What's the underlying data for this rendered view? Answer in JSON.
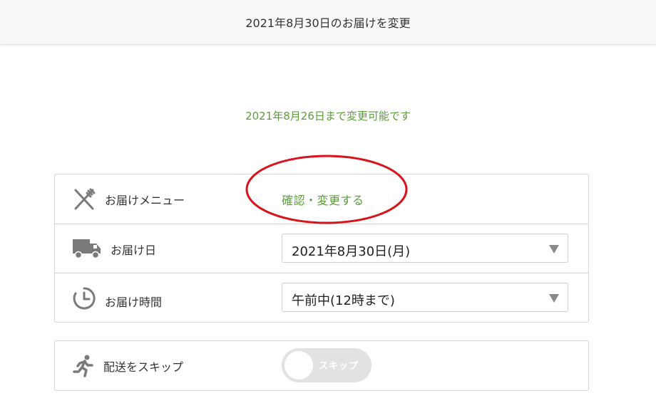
{
  "header": {
    "title": "2021年8月30日のお届けを変更"
  },
  "deadline_text": "2021年8月26日まで変更可能です",
  "rows": {
    "menu": {
      "label": "お届けメニュー",
      "icon": "fork-knife-icon",
      "action": "確認・変更する"
    },
    "date": {
      "label": "お届け日",
      "icon": "truck-icon",
      "selected": "2021年8月30日(月)"
    },
    "time": {
      "label": "お届け時間",
      "icon": "clock-icon",
      "selected": "午前中(12時まで)"
    }
  },
  "skip": {
    "label": "配送をスキップ",
    "icon": "running-person-icon",
    "toggle_text": "スキップ"
  },
  "colors": {
    "accent_green": "#5a9e3a",
    "annotation_red": "#d9121b",
    "toggle_off": "#e2e2e2"
  }
}
